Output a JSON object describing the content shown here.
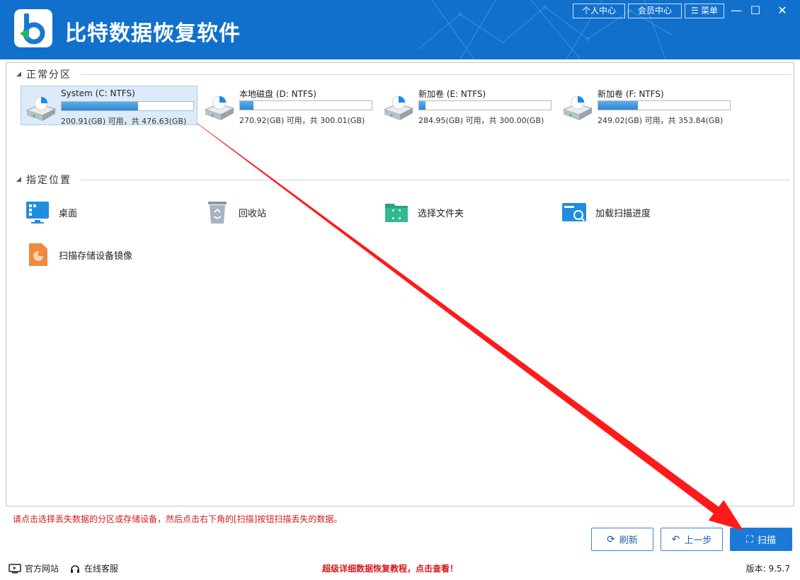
{
  "app": {
    "title": "比特数据恢复软件",
    "header_buttons": {
      "personal_center": "个人中心",
      "member_center": "会员中心",
      "menu": "菜单"
    },
    "window_controls": {
      "minimize": "—",
      "maximize": "☐",
      "close": "✕"
    }
  },
  "sections": {
    "partitions_label": "正常分区",
    "locations_label": "指定位置"
  },
  "drives": [
    {
      "name": "System (C: NTFS)",
      "usage_fraction": 0.58,
      "info": "200.91(GB) 可用，共 476.63(GB)",
      "selected": true
    },
    {
      "name": "本地磁盘 (D: NTFS)",
      "usage_fraction": 0.1,
      "info": "270.92(GB) 可用，共 300.01(GB)",
      "selected": false
    },
    {
      "name": "新加卷 (E: NTFS)",
      "usage_fraction": 0.05,
      "info": "284.95(GB) 可用，共 300.00(GB)",
      "selected": false
    },
    {
      "name": "新加卷 (F: NTFS)",
      "usage_fraction": 0.3,
      "info": "249.02(GB) 可用，共 353.84(GB)",
      "selected": false
    }
  ],
  "locations": [
    {
      "label": "桌面",
      "icon": "desktop-icon"
    },
    {
      "label": "回收站",
      "icon": "recycle-bin-icon"
    },
    {
      "label": "选择文件夹",
      "icon": "folder-icon"
    },
    {
      "label": "加载扫描进度",
      "icon": "load-progress-icon"
    },
    {
      "label": "扫描存储设备镜像",
      "icon": "disk-image-icon"
    }
  ],
  "footer": {
    "hint": "请点击选择丢失数据的分区或存储设备，然后点击右下角的[扫描]按钮扫描丢失的数据。",
    "refresh": "刷新",
    "back": "上一步",
    "scan": "扫描",
    "official_site": "官方网站",
    "online_service": "在线客服",
    "tutorial": "超级详细数据恢复教程，点击查看！",
    "version": "版本: 9.5.7"
  },
  "colors": {
    "title_bar": "#1170cc",
    "accent": "#1b7ad8",
    "hint_text": "#d6191c",
    "annotation_arrow": "#ff1a1a"
  }
}
